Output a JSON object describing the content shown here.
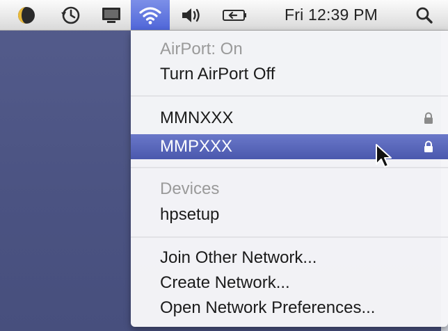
{
  "menubar": {
    "clock": "Fri 12:39 PM",
    "icons": [
      "app-status-icon",
      "time-machine-icon",
      "display-icon",
      "wifi-icon",
      "volume-icon",
      "battery-icon",
      "spotlight-search-icon"
    ]
  },
  "airport_menu": {
    "status": "AirPort: On",
    "toggle_label": "Turn AirPort Off",
    "networks": [
      {
        "name": "MMNXXX",
        "secured": true
      },
      {
        "name": "MMPXXX",
        "secured": true,
        "highlighted": true
      }
    ],
    "devices_header": "Devices",
    "devices": [
      {
        "name": "hpsetup"
      }
    ],
    "actions": {
      "join_other": "Join Other Network...",
      "create": "Create Network...",
      "open_prefs": "Open Network Preferences..."
    }
  },
  "colors": {
    "highlight": "#5562b8",
    "wifi_menu_active": "#5a6fdc",
    "desktop": "#4e5685"
  }
}
